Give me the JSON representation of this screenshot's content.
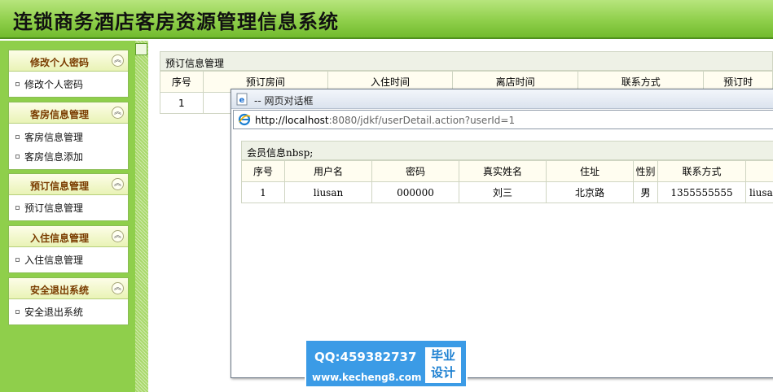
{
  "header": {
    "title": "连锁商务酒店客房资源管理信息系统"
  },
  "sidebar": {
    "panels": [
      {
        "title": "修改个人密码",
        "items": [
          "修改个人密码"
        ]
      },
      {
        "title": "客房信息管理",
        "items": [
          "客房信息管理",
          "客房信息添加"
        ]
      },
      {
        "title": "预订信息管理",
        "items": [
          "预订信息管理"
        ]
      },
      {
        "title": "入住信息管理",
        "items": [
          "入住信息管理"
        ]
      },
      {
        "title": "安全退出系统",
        "items": [
          "安全退出系统"
        ]
      }
    ]
  },
  "main": {
    "section_title": "预订信息管理",
    "columns": [
      "序号",
      "预订房间",
      "入住时间",
      "离店时间",
      "联系方式",
      "预订时"
    ],
    "rows": [
      [
        "1",
        "",
        "",
        "",
        "",
        ""
      ]
    ]
  },
  "dialog": {
    "title": "-- 网页对话框",
    "address_host": "http://localhost",
    "address_rest": ":8080/jdkf/userDetail.action?userId=1",
    "section_title": "会员信息nbsp;",
    "columns": [
      "序号",
      "用户名",
      "密码",
      "真实姓名",
      "住址",
      "性别",
      "联系方式",
      ""
    ],
    "rows": [
      [
        "1",
        "liusan",
        "000000",
        "刘三",
        "北京路",
        "男",
        "1355555555",
        "liusan"
      ]
    ]
  },
  "watermark": {
    "qq": "QQ:459382737",
    "site": "www.kecheng8.com",
    "badge_line1": "毕业",
    "badge_line2": "设计"
  },
  "colors": {
    "header_green": "#8fcf4b",
    "panel_title": "#7a3c00",
    "watermark_blue": "#3b9be6"
  }
}
